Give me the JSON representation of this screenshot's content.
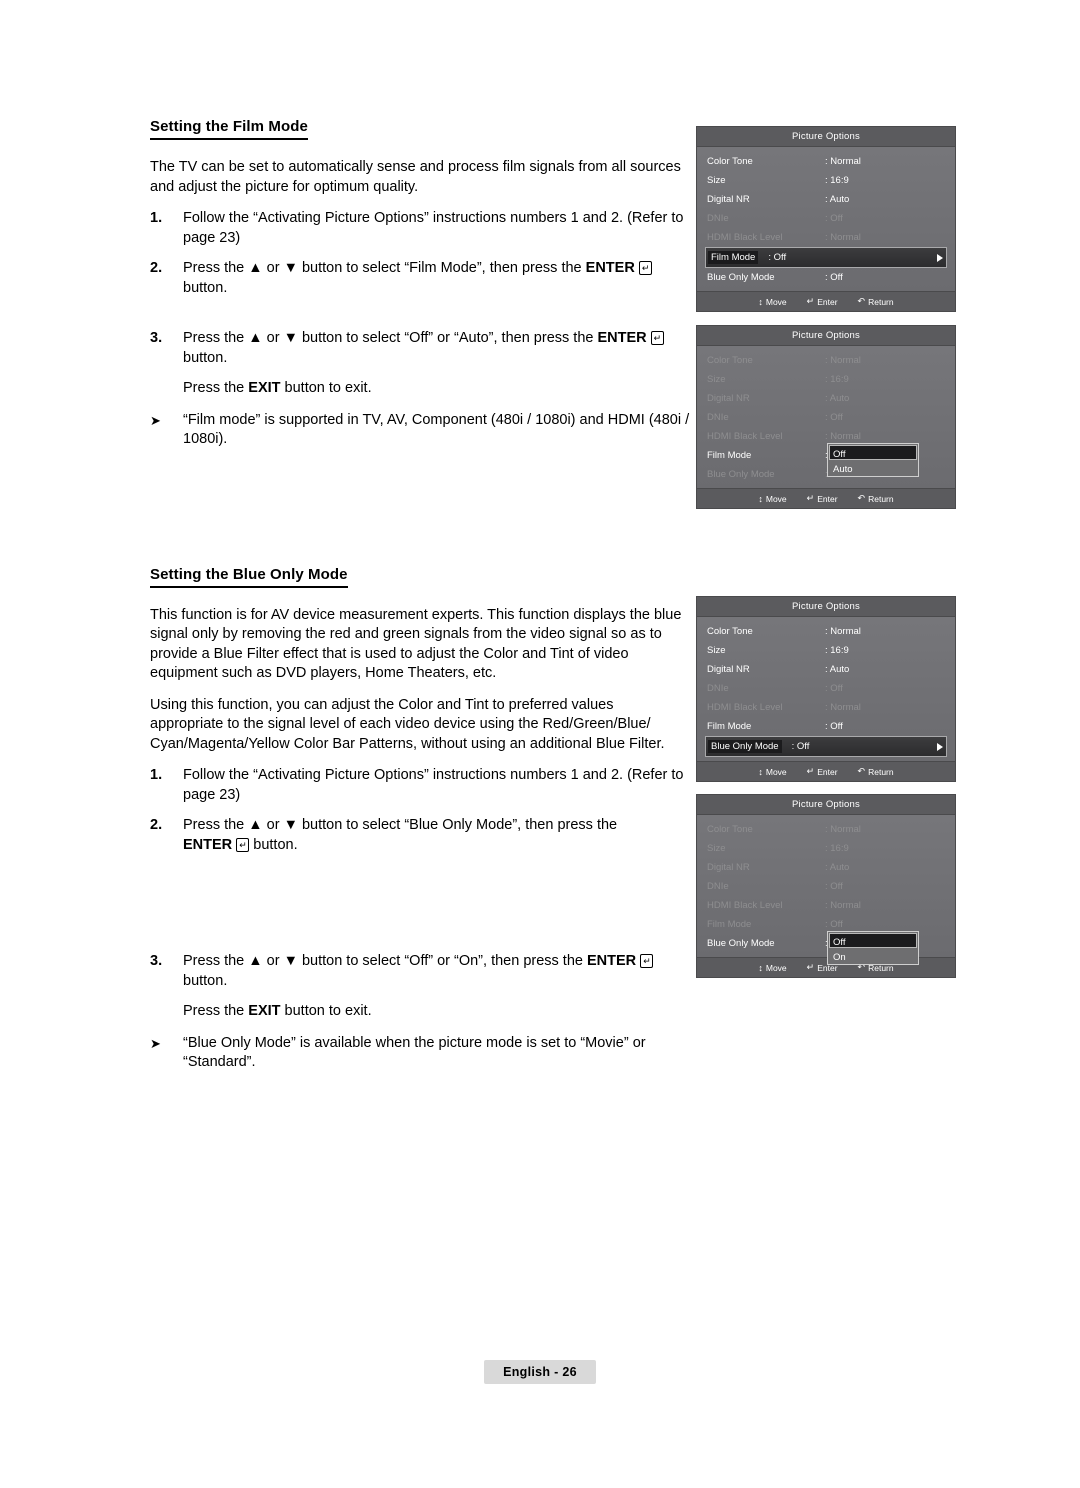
{
  "sections": [
    {
      "title": "Setting the Film Mode",
      "intro": "The TV can be set to automatically sense and process film signals from all sources and adjust the picture for optimum quality.",
      "steps": [
        {
          "num": "1.",
          "text": "Follow the “Activating Picture Options” instructions numbers 1 and 2. (Refer to page 23)"
        },
        {
          "num": "2.",
          "text_before": "Press the ▲ or ▼ button to select “Film Mode”, then press the ",
          "bold": "ENTER",
          "text_after": " button."
        },
        {
          "num": "3.",
          "text_before": "Press the ▲ or ▼ button to select “Off” or “Auto”, then press the ",
          "bold": "ENTER",
          "text_after": " button."
        }
      ],
      "exit_before": "Press the ",
      "exit_bold": "EXIT",
      "exit_after": " button to exit.",
      "note": "“Film mode” is supported in TV, AV, Component (480i / 1080i) and HDMI (480i / 1080i)."
    },
    {
      "title": "Setting the Blue Only Mode",
      "intro": "This function is for AV device measurement experts. This function displays the blue signal only by removing the red and green signals from the video signal so as to provide a Blue Filter effect that is used to adjust the Color and Tint of video equipment such as DVD players, Home Theaters, etc.",
      "intro2": "Using this function, you can adjust the Color and Tint to preferred values appropriate to the signal level of each video device using the Red/Green/Blue/ Cyan/Magenta/Yellow Color Bar Patterns, without using an additional Blue Filter.",
      "steps": [
        {
          "num": "1.",
          "text": "Follow the “Activating Picture Options” instructions numbers 1 and 2. (Refer to page 23)"
        },
        {
          "num": "2.",
          "text_before": "Press the ▲ or ▼ button to select “Blue Only Mode”, then press the ",
          "bold": "ENTER",
          "text_after": " button."
        },
        {
          "num": "3.",
          "text_before": "Press the ▲ or ▼ button to select “Off” or “On”, then press the ",
          "bold": "ENTER",
          "text_after": " button."
        }
      ],
      "exit_before": "Press the ",
      "exit_bold": "EXIT",
      "exit_after": " button to exit.",
      "note": "“Blue Only Mode” is available when the picture mode is set to “Movie” or “Standard”."
    }
  ],
  "osd": {
    "title": "Picture Options",
    "footer": {
      "move": "Move",
      "enter": "Enter",
      "return": "Return"
    },
    "panel1": {
      "rows": [
        {
          "label": "Color Tone",
          "value": ": Normal",
          "state": "normal"
        },
        {
          "label": "Size",
          "value": ": 16:9",
          "state": "normal"
        },
        {
          "label": "Digital NR",
          "value": ": Auto",
          "state": "normal"
        },
        {
          "label": "DNIe",
          "value": ": Off",
          "state": "dim"
        },
        {
          "label": "HDMI Black Level",
          "value": ": Normal",
          "state": "dim"
        },
        {
          "label": "Film Mode",
          "value": ": Off",
          "state": "selected"
        },
        {
          "label": "Blue Only Mode",
          "value": ": Off",
          "state": "normal"
        }
      ]
    },
    "panel2": {
      "rows": [
        {
          "label": "Color Tone",
          "value": ": Normal",
          "state": "dim"
        },
        {
          "label": "Size",
          "value": ": 16:9",
          "state": "dim"
        },
        {
          "label": "Digital NR",
          "value": ": Auto",
          "state": "dim"
        },
        {
          "label": "DNIe",
          "value": ": Off",
          "state": "dim"
        },
        {
          "label": "HDMI Black Level",
          "value": ": Normal",
          "state": "dim"
        },
        {
          "label": "Film Mode",
          "value": ":",
          "state": "normal"
        },
        {
          "label": "Blue Only Mode",
          "value": ": Off",
          "state": "dim"
        }
      ],
      "popup": {
        "selected": "Off",
        "other": "Auto"
      }
    },
    "panel3": {
      "rows": [
        {
          "label": "Color Tone",
          "value": ": Normal",
          "state": "normal"
        },
        {
          "label": "Size",
          "value": ": 16:9",
          "state": "normal"
        },
        {
          "label": "Digital NR",
          "value": ": Auto",
          "state": "normal"
        },
        {
          "label": "DNIe",
          "value": ": Off",
          "state": "dim"
        },
        {
          "label": "HDMI Black Level",
          "value": ": Normal",
          "state": "dim"
        },
        {
          "label": "Film Mode",
          "value": ": Off",
          "state": "normal"
        },
        {
          "label": "Blue Only Mode",
          "value": ": Off",
          "state": "selected"
        }
      ]
    },
    "panel4": {
      "rows": [
        {
          "label": "Color Tone",
          "value": ": Normal",
          "state": "dim"
        },
        {
          "label": "Size",
          "value": ": 16:9",
          "state": "dim"
        },
        {
          "label": "Digital NR",
          "value": ": Auto",
          "state": "dim"
        },
        {
          "label": "DNIe",
          "value": ": Off",
          "state": "dim"
        },
        {
          "label": "HDMI Black Level",
          "value": ": Normal",
          "state": "dim"
        },
        {
          "label": "Film Mode",
          "value": ": Off",
          "state": "dim"
        },
        {
          "label": "Blue Only Mode",
          "value": ":",
          "state": "normal"
        }
      ],
      "popup": {
        "selected": "Off",
        "other": "On"
      }
    }
  },
  "page_footer": "English - 26"
}
